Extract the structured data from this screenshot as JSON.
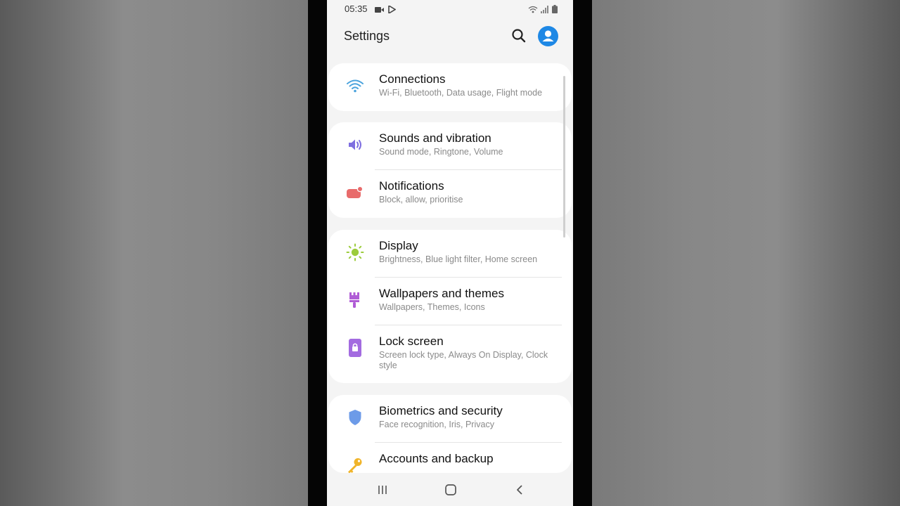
{
  "status_bar": {
    "time": "05:35",
    "left_icons": [
      "video-icon",
      "play-store-icon"
    ],
    "right_icons": [
      "wifi-icon",
      "signal-icon",
      "battery-icon"
    ]
  },
  "app_bar": {
    "title": "Settings",
    "search_icon": "search-icon",
    "profile_icon": "account-icon",
    "accent_color": "#1e88e5"
  },
  "groups": [
    {
      "items": [
        {
          "title": "Connections",
          "subtitle": "Wi-Fi, Bluetooth, Data usage, Flight mode",
          "icon": "wifi-icon",
          "color": "#4ba3dd"
        }
      ]
    },
    {
      "items": [
        {
          "title": "Sounds and vibration",
          "subtitle": "Sound mode, Ringtone, Volume",
          "icon": "volume-icon",
          "color": "#7e6ee0"
        },
        {
          "title": "Notifications",
          "subtitle": "Block, allow, prioritise",
          "icon": "notification-icon",
          "color": "#e86b6b"
        }
      ]
    },
    {
      "items": [
        {
          "title": "Display",
          "subtitle": "Brightness, Blue light filter, Home screen",
          "icon": "brightness-icon",
          "color": "#9ccc3c"
        },
        {
          "title": "Wallpapers and themes",
          "subtitle": "Wallpapers, Themes, Icons",
          "icon": "paintbrush-icon",
          "color": "#b05cd6"
        },
        {
          "title": "Lock screen",
          "subtitle": "Screen lock type, Always On Display, Clock style",
          "icon": "lock-icon",
          "color": "#a36be0"
        }
      ]
    },
    {
      "items": [
        {
          "title": "Biometrics and security",
          "subtitle": "Face recognition, Iris, Privacy",
          "icon": "shield-icon",
          "color": "#6d9be8"
        },
        {
          "title": "Accounts and backup",
          "subtitle": "",
          "icon": "key-icon",
          "color": "#f0b429"
        }
      ]
    }
  ],
  "nav_bar": {
    "buttons": [
      "recents-icon",
      "home-icon",
      "back-icon"
    ]
  }
}
